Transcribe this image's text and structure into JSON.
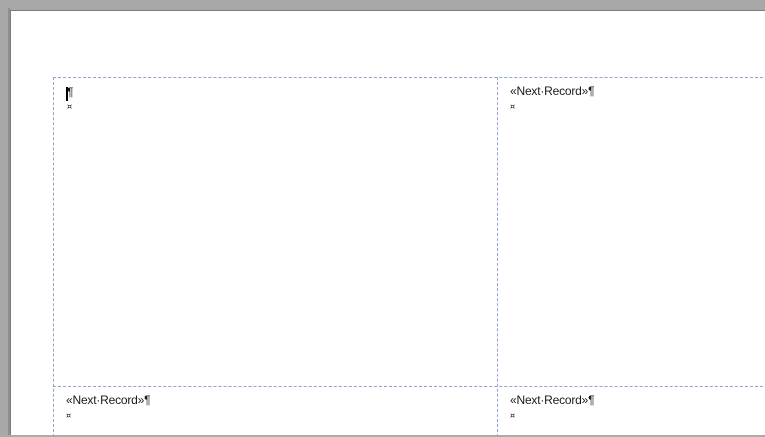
{
  "document": {
    "cells": [
      {
        "text": "¶",
        "end_mark": "¤",
        "has_cursor": true
      },
      {
        "text": "«Next·Record»¶",
        "end_mark": "¤",
        "has_cursor": false
      },
      {
        "text": "«Next·Record»¶",
        "end_mark": "¤",
        "has_cursor": false
      },
      {
        "text": "«Next·Record»¶",
        "end_mark": "¤",
        "has_cursor": false
      }
    ]
  },
  "colors": {
    "gridline": "#8fa6c6",
    "page_background": "#ffffff",
    "workspace_background": "#a8a8a8"
  }
}
